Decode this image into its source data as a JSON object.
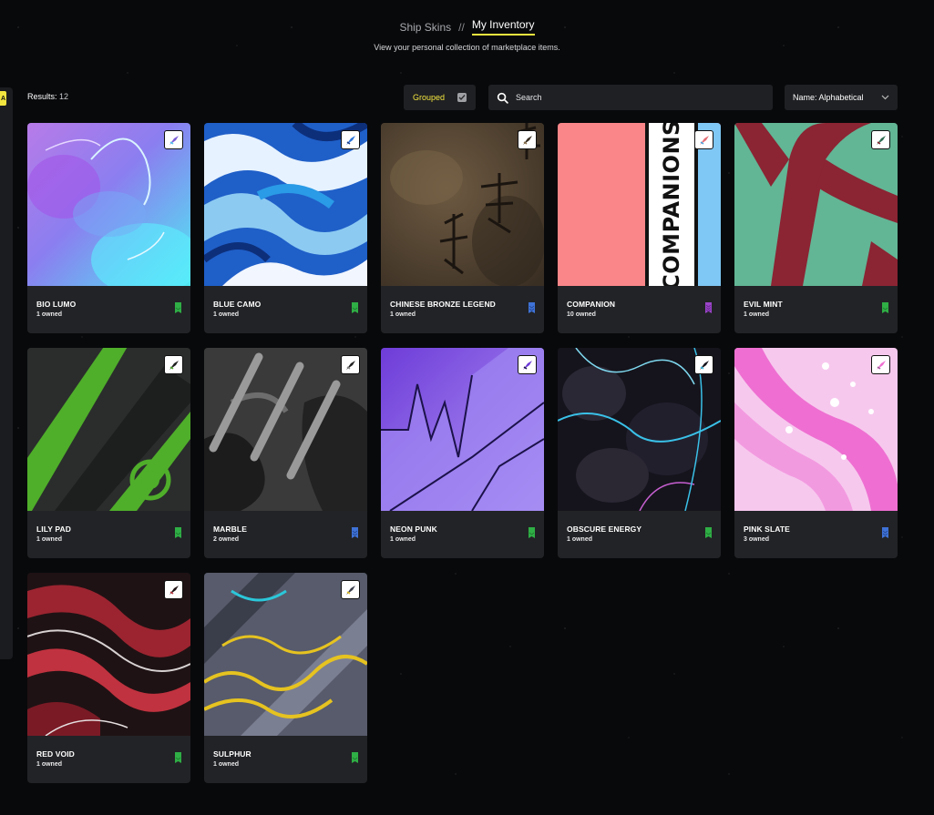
{
  "breadcrumb": {
    "parent": "Ship Skins",
    "separator": "//",
    "current": "My Inventory"
  },
  "subtitle": "View your personal collection of marketplace items.",
  "side_badge": "A",
  "results": {
    "label": "Results:",
    "count": "12"
  },
  "filters": {
    "grouped_label": "Grouped",
    "grouped_checked": true,
    "search_placeholder": "Search",
    "sort_value": "Name: Alphabetical"
  },
  "colors": {
    "accent_yellow": "#f3e53f",
    "rarity_green": "#2fae45",
    "rarity_blue": "#3f72d6",
    "rarity_purple": "#9b45c9"
  },
  "items": [
    {
      "name": "BIO LUMO",
      "owned": "1 owned",
      "rarity": "green",
      "icon": "ship-icon"
    },
    {
      "name": "BLUE CAMO",
      "owned": "1 owned",
      "rarity": "green",
      "icon": "ship-icon"
    },
    {
      "name": "CHINESE BRONZE LEGEND",
      "owned": "1 owned",
      "rarity": "blue",
      "icon": "ship-icon"
    },
    {
      "name": "COMPANION",
      "owned": "10 owned",
      "rarity": "purple",
      "icon": "ship-icon",
      "art_text": "COMPANIONS"
    },
    {
      "name": "EVIL MINT",
      "owned": "1 owned",
      "rarity": "green",
      "icon": "ship-icon"
    },
    {
      "name": "LILY PAD",
      "owned": "1 owned",
      "rarity": "green",
      "icon": "ship-icon"
    },
    {
      "name": "MARBLE",
      "owned": "2 owned",
      "rarity": "blue",
      "icon": "ship-icon"
    },
    {
      "name": "NEON PUNK",
      "owned": "1 owned",
      "rarity": "green",
      "icon": "ship-icon"
    },
    {
      "name": "OBSCURE ENERGY",
      "owned": "1 owned",
      "rarity": "green",
      "icon": "ship-icon"
    },
    {
      "name": "PINK SLATE",
      "owned": "3 owned",
      "rarity": "blue",
      "icon": "ship-icon"
    },
    {
      "name": "RED VOID",
      "owned": "1 owned",
      "rarity": "green",
      "icon": "ship-icon"
    },
    {
      "name": "SULPHUR",
      "owned": "1 owned",
      "rarity": "green",
      "icon": "ship-icon"
    }
  ]
}
